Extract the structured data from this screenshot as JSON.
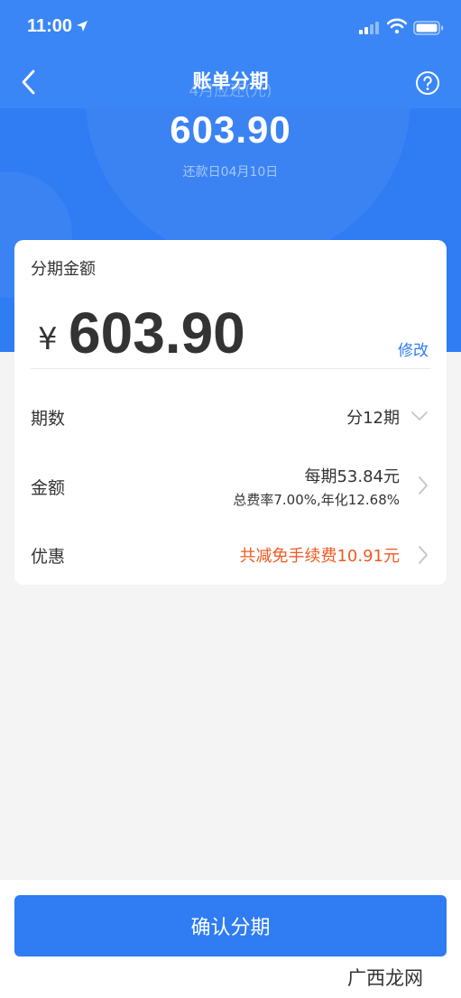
{
  "status_bar": {
    "time": "11:00"
  },
  "nav": {
    "title": "账单分期",
    "ghost_text": "4月应还(元)"
  },
  "hero": {
    "amount": "603.90",
    "due_text": "还款日04月10日"
  },
  "card": {
    "label": "分期金额",
    "currency": "¥",
    "amount": "603.90",
    "modify_label": "修改",
    "rows": {
      "periods": {
        "key": "期数",
        "value": "分12期"
      },
      "amount": {
        "key": "金额",
        "value": "每期53.84元",
        "sub": "总费率7.00%,年化12.68%"
      },
      "discount": {
        "key": "优惠",
        "value": "共减免手续费10.91元"
      }
    }
  },
  "confirm_label": "确认分期",
  "watermark": "广西龙网",
  "colors": {
    "primary": "#2f7cf3",
    "discount": "#f05a22"
  }
}
